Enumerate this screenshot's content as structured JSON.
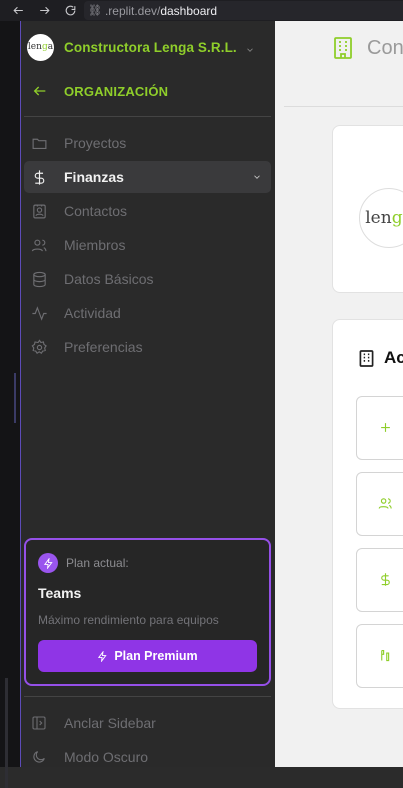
{
  "browser": {
    "url_prefix": ".replit.dev/",
    "url_path": "dashboard"
  },
  "org": {
    "name": "Constructora Lenga S.R.L.",
    "logo_text": "lenga"
  },
  "back": {
    "label": "ORGANIZACIÓN"
  },
  "nav": {
    "items": [
      {
        "label": "Proyectos",
        "icon": "folder-icon"
      },
      {
        "label": "Finanzas",
        "icon": "dollar-icon",
        "active": true
      },
      {
        "label": "Contactos",
        "icon": "contact-card-icon"
      },
      {
        "label": "Miembros",
        "icon": "users-icon"
      },
      {
        "label": "Datos Básicos",
        "icon": "database-icon"
      },
      {
        "label": "Actividad",
        "icon": "activity-icon"
      },
      {
        "label": "Preferencias",
        "icon": "gear-icon"
      }
    ]
  },
  "plan": {
    "heading": "Plan actual:",
    "name": "Teams",
    "description": "Máximo rendimiento para equipos",
    "button_label": "Plan Premium"
  },
  "bottom": {
    "pin_label": "Anclar Sidebar",
    "dark_label": "Modo Oscuro"
  },
  "main": {
    "header_title": "Con",
    "section_title": "Ac"
  },
  "colors": {
    "accent_green": "#8fce2a",
    "plan_purple": "#8f35e6"
  }
}
